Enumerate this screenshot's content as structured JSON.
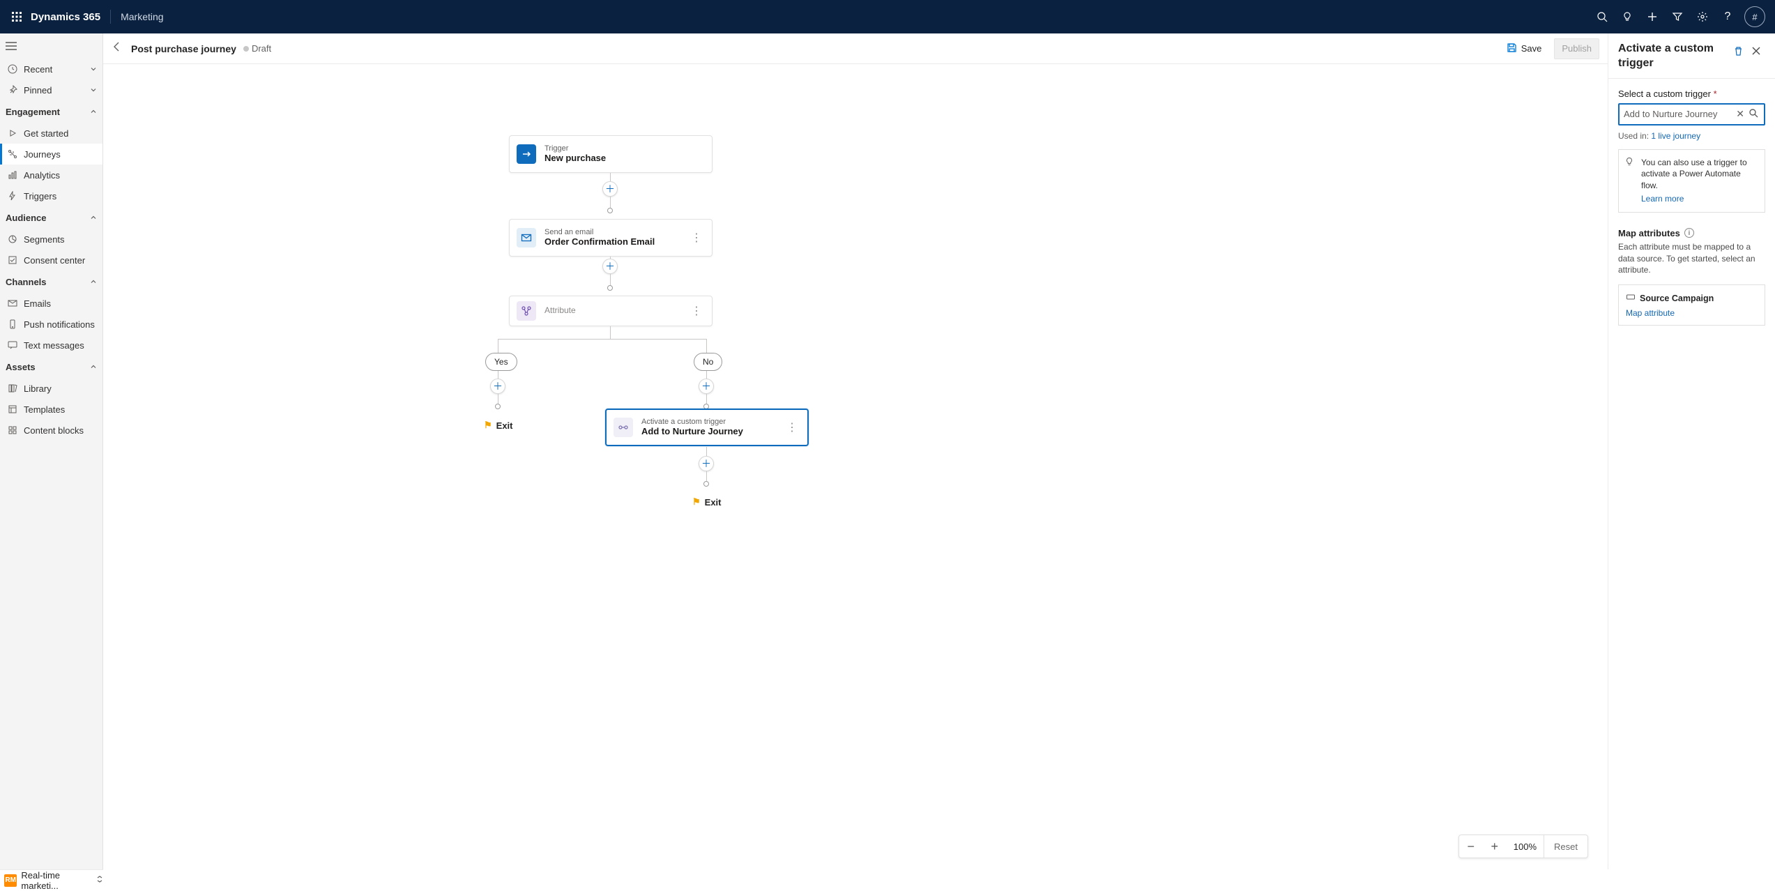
{
  "app": {
    "title": "Dynamics 365",
    "module": "Marketing",
    "avatar": "#"
  },
  "sidebar": {
    "recent": "Recent",
    "pinned": "Pinned",
    "sections": {
      "engagement": "Engagement",
      "audience": "Audience",
      "channels": "Channels",
      "assets": "Assets"
    },
    "items": {
      "get_started": "Get started",
      "journeys": "Journeys",
      "analytics": "Analytics",
      "triggers": "Triggers",
      "segments": "Segments",
      "consent": "Consent center",
      "emails": "Emails",
      "push": "Push notifications",
      "text": "Text messages",
      "library": "Library",
      "templates": "Templates",
      "blocks": "Content blocks"
    }
  },
  "page": {
    "back": "Back",
    "name": "Post purchase journey",
    "status": "Draft",
    "save": "Save",
    "publish": "Publish"
  },
  "cards": {
    "trigger": {
      "sub": "Trigger",
      "title": "New purchase"
    },
    "email": {
      "sub": "Send an email",
      "title": "Order Confirmation Email"
    },
    "attribute": {
      "sub": "Attribute"
    },
    "custom": {
      "sub": "Activate a custom trigger",
      "title": "Add to Nurture Journey"
    }
  },
  "branch": {
    "yes": "Yes",
    "no": "No",
    "exit": "Exit"
  },
  "zoom": {
    "value": "100%",
    "reset": "Reset"
  },
  "panel": {
    "title": "Activate a custom trigger",
    "select_label": "Select a custom trigger",
    "select_value": "Add to Nurture Journey",
    "used_in_label": "Used in:",
    "used_in_link": "1 live journey",
    "tip": "You can also use a trigger to activate a Power Automate flow.",
    "learn_more": "Learn more",
    "map_title": "Map attributes",
    "map_desc": "Each attribute must be mapped to a data source. To get started, select an attribute.",
    "attr_name": "Source Campaign",
    "map_link": "Map attribute"
  },
  "footer": {
    "badge": "RM",
    "label": "Real-time marketi..."
  }
}
